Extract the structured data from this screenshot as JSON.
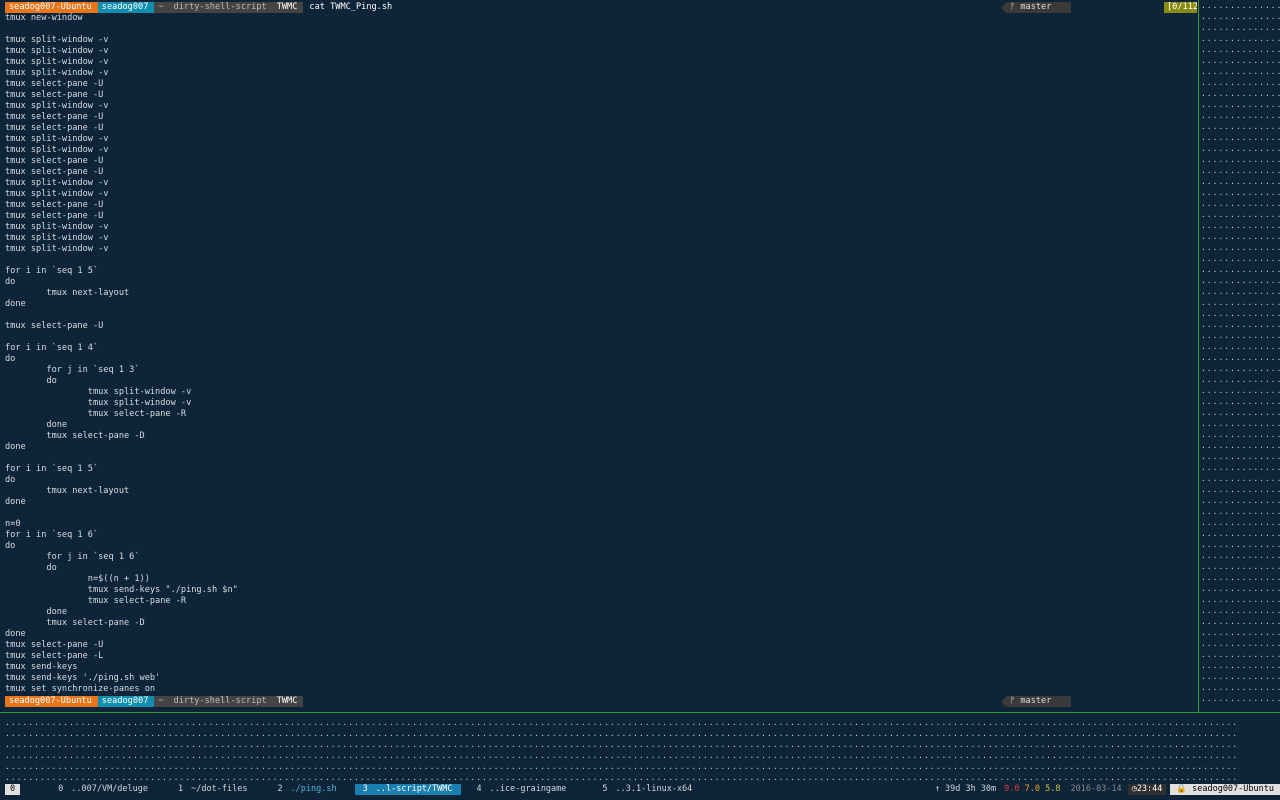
{
  "prompt_top": {
    "host": "seadog007-Ubuntu",
    "user": "seadog007",
    "path": [
      "~",
      "dirty-shell-script",
      "TWMC"
    ],
    "command": "cat TWMC_Ping.sh",
    "branch": "master",
    "counter": "[0/112]"
  },
  "script_lines": "tmux new-window\n\ntmux split-window -v\ntmux split-window -v\ntmux split-window -v\ntmux split-window -v\ntmux select-pane -U\ntmux select-pane -U\ntmux split-window -v\ntmux select-pane -U\ntmux select-pane -U\ntmux split-window -v\ntmux split-window -v\ntmux select-pane -U\ntmux select-pane -U\ntmux split-window -v\ntmux split-window -v\ntmux select-pane -U\ntmux select-pane -U\ntmux split-window -v\ntmux split-window -v\ntmux split-window -v\n\nfor i in `seq 1 5`\ndo\n        tmux next-layout\ndone\n\ntmux select-pane -U\n\nfor i in `seq 1 4`\ndo\n        for j in `seq 1 3`\n        do\n                tmux split-window -v\n                tmux split-window -v\n                tmux select-pane -R\n        done\n        tmux select-pane -D\ndone\n\nfor i in `seq 1 5`\ndo\n        tmux next-layout\ndone\n\nn=0\nfor i in `seq 1 6`\ndo\n        for j in `seq 1 6`\n        do\n                n=$((n + 1))\n                tmux send-keys \"./ping.sh $n\"\n                tmux select-pane -R\n        done\n        tmux select-pane -D\ndone\ntmux select-pane -U\ntmux select-pane -L\ntmux send-keys\ntmux send-keys './ping.sh web'\ntmux set synchronize-panes on",
  "prompt_bottom": {
    "host": "seadog007-Ubuntu",
    "user": "seadog007",
    "path": [
      "~",
      "dirty-shell-script",
      "TWMC"
    ],
    "branch": "master"
  },
  "statusbar": {
    "session": "0",
    "windows": [
      {
        "num": "0",
        "name": "..007/VM/deluge"
      },
      {
        "num": "1",
        "name": "~/dot-files"
      },
      {
        "num": "2",
        "name": "./ping.sh"
      },
      {
        "num": "3",
        "name": "..l-script/TWMC"
      },
      {
        "num": "4",
        "name": "..ice-graingame"
      },
      {
        "num": "5",
        "name": "..3.1-linux-x64"
      }
    ],
    "uptime": "↑  39d 3h 30m",
    "load": [
      "9.0",
      "7.0",
      "5.8"
    ],
    "date": "2016-03-14",
    "time": "23:44",
    "hostname": "seadog007-Ubuntu"
  }
}
